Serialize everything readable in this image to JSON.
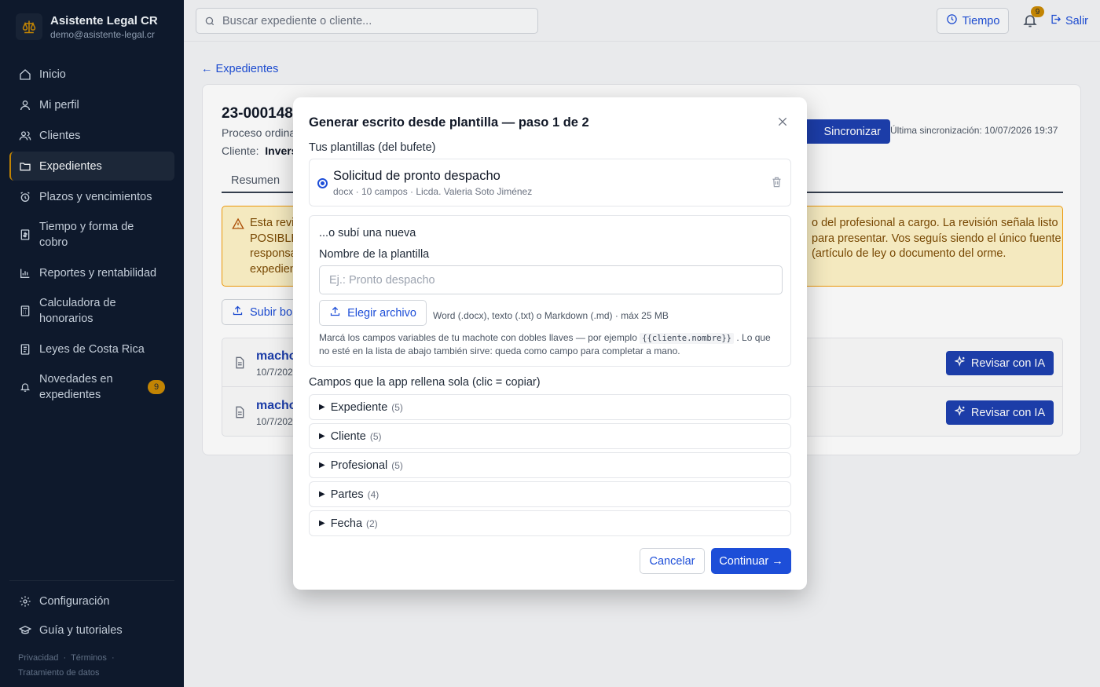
{
  "app": {
    "name": "Asistente Legal CR",
    "email": "demo@asistente-legal.cr"
  },
  "sidebar": {
    "items": [
      {
        "label": "Inicio",
        "icon": "home-icon"
      },
      {
        "label": "Mi perfil",
        "icon": "user-icon"
      },
      {
        "label": "Clientes",
        "icon": "users-icon"
      },
      {
        "label": "Expedientes",
        "icon": "folder-icon",
        "active": true
      },
      {
        "label": "Plazos y vencimientos",
        "icon": "alarm-icon"
      },
      {
        "label": "Tiempo y forma de cobro",
        "icon": "invoice-icon"
      },
      {
        "label": "Reportes y rentabilidad",
        "icon": "chart-icon"
      },
      {
        "label": "Calculadora de honorarios",
        "icon": "calculator-icon"
      },
      {
        "label": "Leyes de Costa Rica",
        "icon": "book-icon"
      },
      {
        "label": "Novedades en expedientes",
        "icon": "bell-icon",
        "badge": "9"
      }
    ],
    "bottom": [
      {
        "label": "Configuración",
        "icon": "gear-icon"
      },
      {
        "label": "Guía y tutoriales",
        "icon": "graduation-icon"
      }
    ],
    "legal": {
      "privacy": "Privacidad",
      "terms": "Términos",
      "data": "Tratamiento de datos",
      "sep": "·"
    }
  },
  "topbar": {
    "search_placeholder": "Buscar expediente o cliente...",
    "tiempo_label": "Tiempo",
    "notifications_count": "9",
    "logout_label": "Salir"
  },
  "page": {
    "back_link": "← Expedientes",
    "case_number": "23-000148",
    "process": "Proceso ordina",
    "client_label": "Cliente:",
    "client_value": "Invers",
    "sync_label": "Sincronizar",
    "last_sync": "Última sincronización: 10/07/2026 19:37",
    "tab_resumen": "Resumen",
    "warning_left": [
      "Esta revi",
      "POSIBLE",
      "responsa",
      "expedien"
    ],
    "warning_right": "o del profesional a cargo. La revisión señala listo para presentar. Vos seguís siendo el único fuente (artículo de ley o documento del orme.",
    "upload_label": "Subir bor",
    "files": [
      {
        "name": "macho",
        "date": "10/7/202",
        "action": "Revisar con IA"
      },
      {
        "name": "macho",
        "date": "10/7/202",
        "action": "Revisar con IA"
      }
    ]
  },
  "modal": {
    "title": "Generar escrito desde plantilla — paso 1 de 2",
    "templates_label": "Tus plantillas (del bufete)",
    "template": {
      "name": "Solicitud de pronto despacho",
      "meta": "docx · 10 campos · Licda. Valeria Soto Jiménez"
    },
    "upload": {
      "title": "...o subí una nueva",
      "name_label": "Nombre de la plantilla",
      "name_placeholder": "Ej.: Pronto despacho",
      "choose_label": "Elegir archivo",
      "choose_hint": "Word (.docx), texto (.txt) o Markdown (.md) · máx 25 MB",
      "help_before": "Marcá los campos variables de tu machote con dobles llaves — por ejemplo",
      "help_code": "{{cliente.nombre}}",
      "help_after": ". Lo que no esté en la lista de abajo también sirve: queda como campo para completar a mano."
    },
    "fields_label": "Campos que la app rellena sola (clic = copiar)",
    "field_groups": [
      {
        "name": "Expediente",
        "count": "(5)"
      },
      {
        "name": "Cliente",
        "count": "(5)"
      },
      {
        "name": "Profesional",
        "count": "(5)"
      },
      {
        "name": "Partes",
        "count": "(4)"
      },
      {
        "name": "Fecha",
        "count": "(2)"
      }
    ],
    "cancel_label": "Cancelar",
    "continue_label": "Continuar →"
  }
}
